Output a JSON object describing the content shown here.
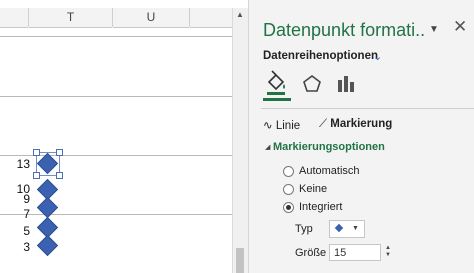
{
  "sheet": {
    "columns": [
      "T",
      "U"
    ],
    "rows": [
      "13",
      "10",
      "9",
      "7",
      "5",
      "3"
    ]
  },
  "pane": {
    "title": "Datenpunkt formati..",
    "menu_icon": "chevron-down-icon",
    "close_label": "✕",
    "series_options_label": "Datenreihenoptionen",
    "tabs": [
      "fill-line-icon",
      "effects-pentagon-icon",
      "series-options-bars-icon"
    ],
    "sub_tabs": {
      "line": "Linie",
      "marker": "Markierung"
    },
    "section_title": "Markierungsoptionen",
    "radio_options": [
      {
        "label": "Automatisch",
        "checked": false
      },
      {
        "label": "Keine",
        "checked": false
      },
      {
        "label": "Integriert",
        "checked": true
      }
    ],
    "type_label": "Typ",
    "size_label": "Größe",
    "size_value": "15"
  },
  "colors": {
    "accent": "#217346",
    "marker": "#3a62b0"
  }
}
